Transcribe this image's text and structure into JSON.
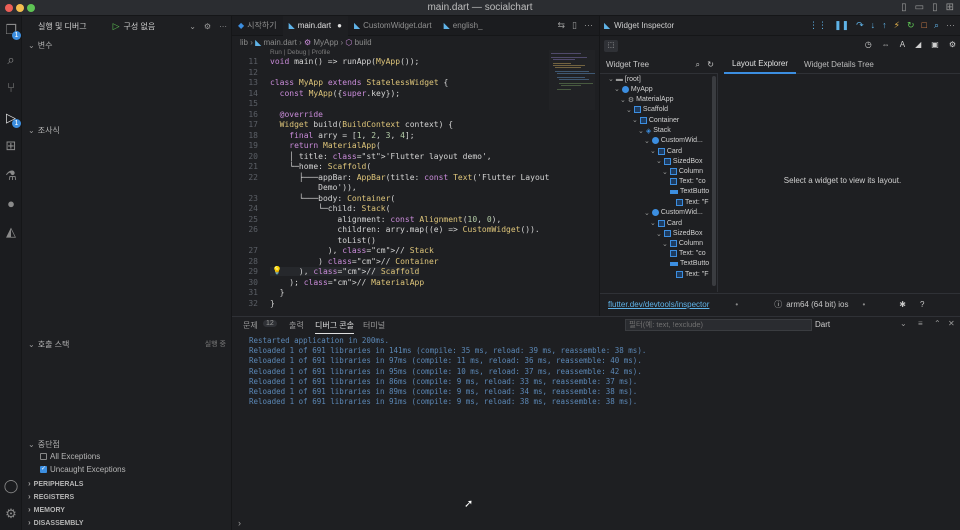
{
  "window": {
    "title": "main.dart — socialchart"
  },
  "sidebar": {
    "run_debug": "실행 및 디버그",
    "config": "구성 없음",
    "variables": "변수",
    "watch": "조사식",
    "call_stack": "호출 스택",
    "call_stack_status": "실행 중",
    "breakpoints": "중단점",
    "all_exceptions": "All Exceptions",
    "uncaught_exceptions": "Uncaught Exceptions",
    "peripherals": "PERIPHERALS",
    "registers": "REGISTERS",
    "memory": "MEMORY",
    "disassembly": "DISASSEMBLY"
  },
  "editor": {
    "tabs": [
      "시작하기",
      "main.dart",
      "CustomWidget.dart",
      "english_"
    ],
    "breadcrumb": [
      "lib",
      "main.dart",
      "MyApp",
      "build"
    ],
    "codelens": "Run | Debug | Profile",
    "lines": [
      {
        "n": "11",
        "t": "void main() => runApp(MyApp());"
      },
      {
        "n": "12",
        "t": ""
      },
      {
        "n": "13",
        "t": "class MyApp extends StatelessWidget {"
      },
      {
        "n": "14",
        "t": "  const MyApp({super.key});"
      },
      {
        "n": "15",
        "t": ""
      },
      {
        "n": "16",
        "t": "  @override"
      },
      {
        "n": "17",
        "t": "  Widget build(BuildContext context) {"
      },
      {
        "n": "18",
        "t": "    final arry = [1, 2, 3, 4];"
      },
      {
        "n": "19",
        "t": "    return MaterialApp("
      },
      {
        "n": "20",
        "t": "    │ title: 'Flutter layout demo',"
      },
      {
        "n": "21",
        "t": "    └─home: Scaffold("
      },
      {
        "n": "22",
        "t": "      ├───appBar: AppBar(title: const Text('Flutter Layout"
      },
      {
        "n": "",
        "t": "          Demo')),"
      },
      {
        "n": "23",
        "t": "      └───body: Container("
      },
      {
        "n": "24",
        "t": "          └─child: Stack("
      },
      {
        "n": "25",
        "t": "              alignment: const Alignment(10, 0),"
      },
      {
        "n": "26",
        "t": "              children: arry.map((e) => CustomWidget())."
      },
      {
        "n": "",
        "t": "              toList()"
      },
      {
        "n": "27",
        "t": "            ), // Stack"
      },
      {
        "n": "28",
        "t": "          ) // Container"
      },
      {
        "n": "29",
        "t": "      ), // Scaffold"
      },
      {
        "n": "30",
        "t": "    ); // MaterialApp"
      },
      {
        "n": "31",
        "t": "  }"
      },
      {
        "n": "32",
        "t": "}"
      }
    ]
  },
  "inspector": {
    "title": "Widget Inspector",
    "widget_tree": "Widget Tree",
    "layout_explorer": "Layout Explorer",
    "details_tree": "Widget Details Tree",
    "empty_msg": "Select a widget to view its layout.",
    "link": "flutter.dev/devtools/inspector",
    "device": "arm64 (64 bit) ios",
    "tree": [
      {
        "label": "[root]",
        "d": 0,
        "icon": "folder"
      },
      {
        "label": "MyApp",
        "d": 1,
        "icon": "dot"
      },
      {
        "label": "MaterialApp",
        "d": 2,
        "icon": "gear"
      },
      {
        "label": "Scaffold",
        "d": 3,
        "icon": "sq"
      },
      {
        "label": "Container",
        "d": 4,
        "icon": "sq"
      },
      {
        "label": "Stack",
        "d": 5,
        "icon": "layers"
      },
      {
        "label": "CustomWid...",
        "d": 6,
        "icon": "dot"
      },
      {
        "label": "Card",
        "d": 7,
        "icon": "sq"
      },
      {
        "label": "SizedBox",
        "d": 8,
        "icon": "sq"
      },
      {
        "label": "Column",
        "d": 9,
        "icon": "sq"
      },
      {
        "label": "Text: \"co",
        "d": 10,
        "icon": "sq"
      },
      {
        "label": "TextButto",
        "d": 10,
        "icon": "bar"
      },
      {
        "label": "Text: \"F",
        "d": 11,
        "icon": "sq"
      },
      {
        "label": "CustomWid...",
        "d": 6,
        "icon": "dot"
      },
      {
        "label": "Card",
        "d": 7,
        "icon": "sq"
      },
      {
        "label": "SizedBox",
        "d": 8,
        "icon": "sq"
      },
      {
        "label": "Column",
        "d": 9,
        "icon": "sq"
      },
      {
        "label": "Text: \"co",
        "d": 10,
        "icon": "sq"
      },
      {
        "label": "TextButto",
        "d": 10,
        "icon": "bar"
      },
      {
        "label": "Text: \"F",
        "d": 11,
        "icon": "sq"
      }
    ]
  },
  "panel": {
    "tabs": [
      "문제",
      "12",
      "출력",
      "디버그 콘솔",
      "터미널"
    ],
    "filter_placeholder": "필터(예: text, !exclude)",
    "language": "Dart",
    "logs": [
      "Restarted application in 200ms.",
      "Reloaded 1 of 691 libraries in 141ms (compile: 35 ms, reload: 39 ms, reassemble: 38 ms).",
      "Reloaded 1 of 691 libraries in 97ms (compile: 11 ms, reload: 36 ms, reassemble: 40 ms).",
      "Reloaded 1 of 691 libraries in 95ms (compile: 10 ms, reload: 37 ms, reassemble: 42 ms).",
      "Reloaded 1 of 691 libraries in 86ms (compile: 9 ms, reload: 33 ms, reassemble: 37 ms).",
      "Reloaded 1 of 691 libraries in 89ms (compile: 9 ms, reload: 34 ms, reassemble: 38 ms).",
      "Reloaded 1 of 691 libraries in 91ms (compile: 9 ms, reload: 38 ms, reassemble: 38 ms)."
    ]
  }
}
